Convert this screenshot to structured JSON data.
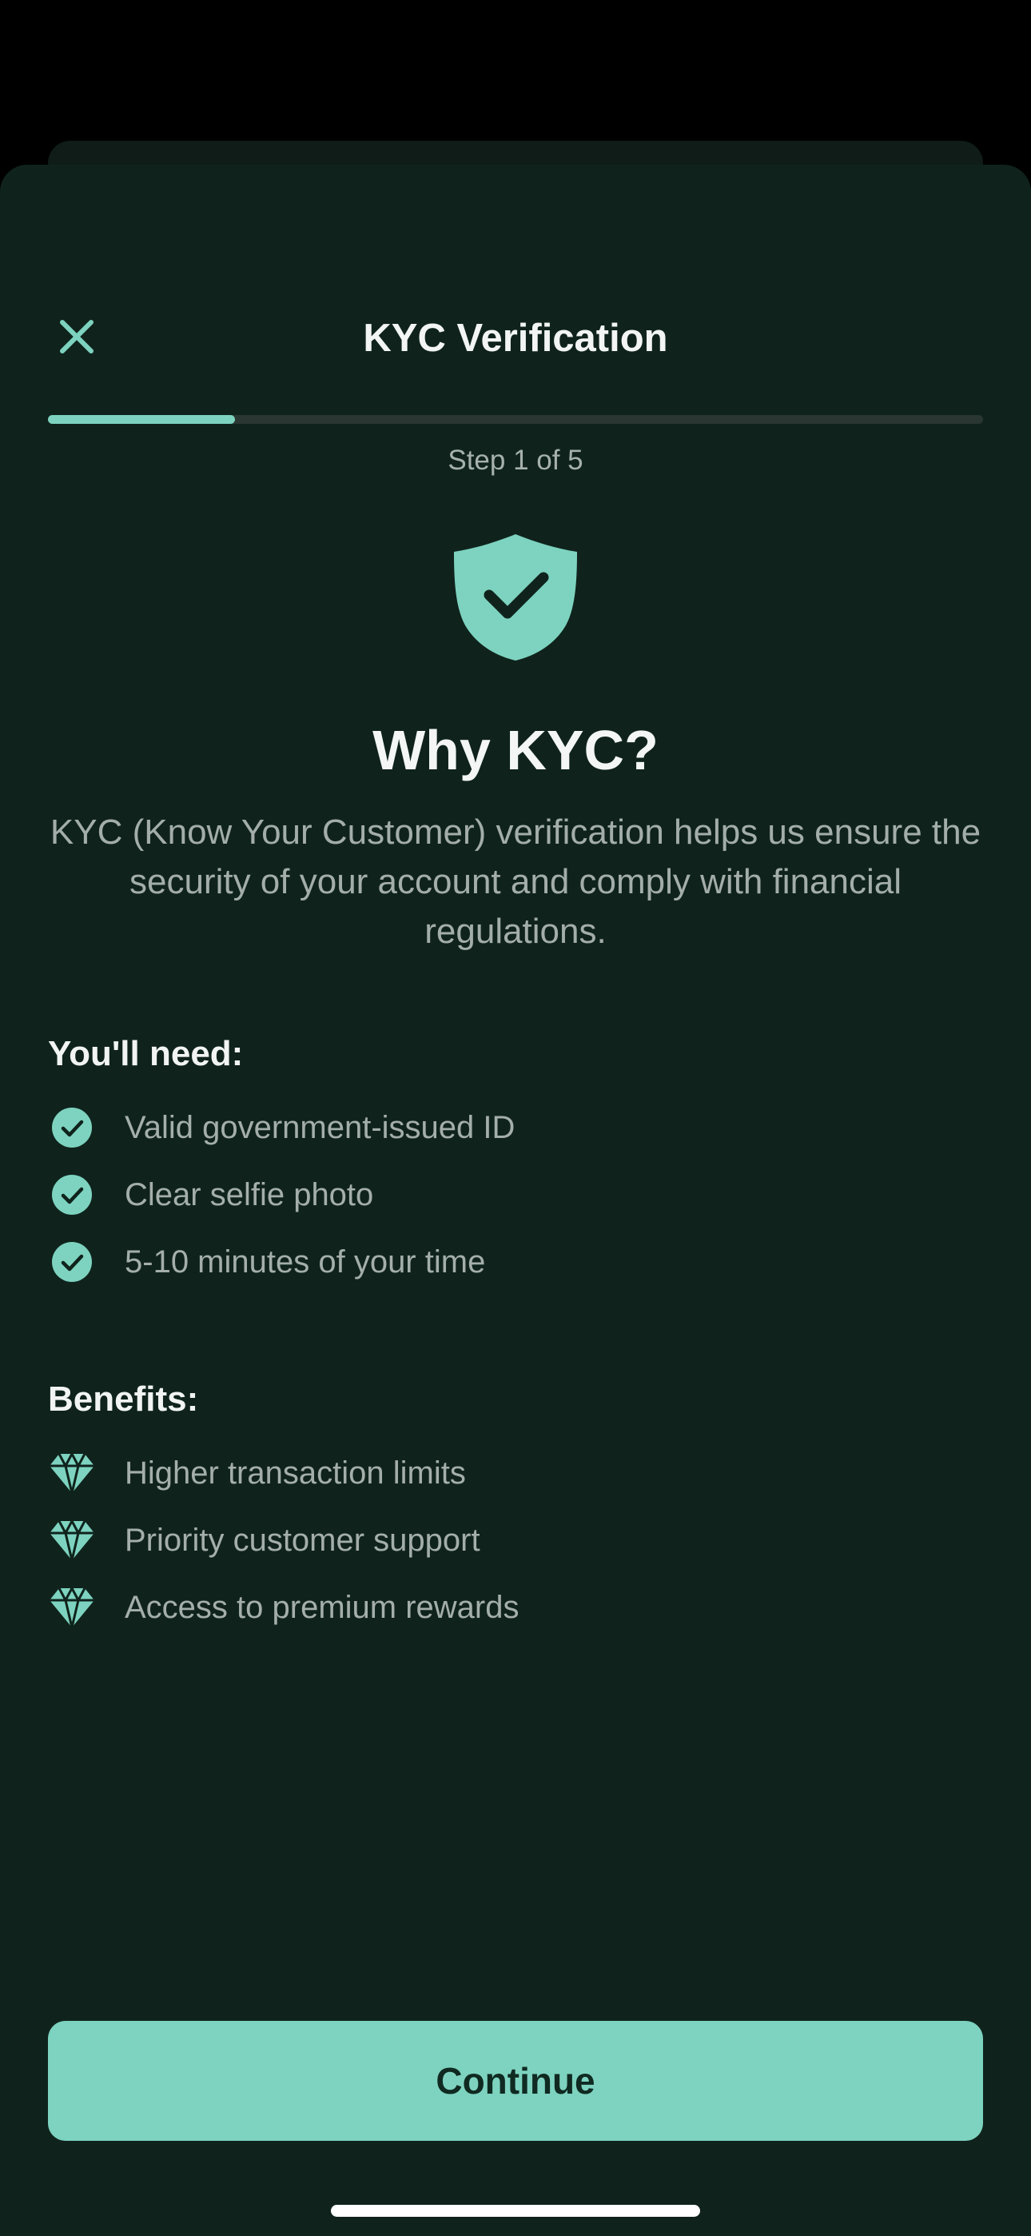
{
  "header": {
    "title": "KYC Verification",
    "close_icon": "close-icon"
  },
  "progress": {
    "step_text": "Step 1 of 5",
    "current_step": 1,
    "total_steps": 5,
    "fraction": 0.2
  },
  "intro": {
    "icon": "shield-check-icon",
    "heading": "Why KYC?",
    "description": "KYC (Know Your Customer) verification helps us ensure the security of your account and comply with financial regulations."
  },
  "needs": {
    "title": "You'll need:",
    "icon": "check-circle-icon",
    "items": [
      {
        "label": "Valid government-issued ID"
      },
      {
        "label": "Clear selfie photo"
      },
      {
        "label": "5-10 minutes of your time"
      }
    ]
  },
  "benefits": {
    "title": "Benefits:",
    "icon": "diamond-icon",
    "items": [
      {
        "label": "Higher transaction limits"
      },
      {
        "label": "Priority customer support"
      },
      {
        "label": "Access to premium rewards"
      }
    ]
  },
  "actions": {
    "continue_label": "Continue"
  },
  "colors": {
    "accent": "#7dd3bf",
    "background": "#0f231c",
    "text_primary": "#f2f5f3",
    "text_secondary": "#a4aeaa"
  }
}
